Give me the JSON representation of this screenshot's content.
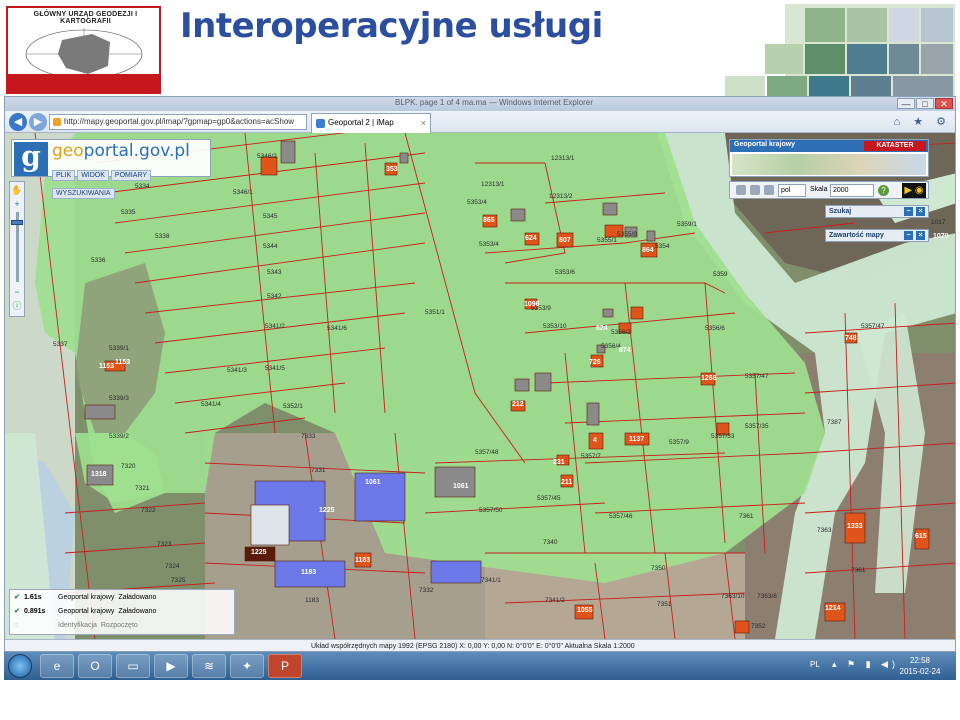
{
  "slide": {
    "logo_text": "GŁÓWNY URZĄD GEODEZJI I KARTOGRAFII",
    "title": "Interoperacyjne usługi"
  },
  "window": {
    "title": "BLPK. page 1 of 4 ma.ma — Windows Internet Explorer",
    "controls": [
      "—",
      "□",
      "✕"
    ]
  },
  "browser": {
    "address": "http://mapy.geoportal.gov.pl/imap/?gpmap=gp0&actions=acShow",
    "tab_title": "Geoportal 2 | iMap",
    "tab_close": "×",
    "back": "◀",
    "forward": "▶",
    "toolbar_icons": "⌂ ★ ⚙"
  },
  "geoportal": {
    "logo_letter": "g",
    "name_prefix": "geo",
    "name_suffix": "portal.gov.pl",
    "menu": [
      "PLIK",
      "WIDOK",
      "POMIARY",
      "WYSZUKIWANIA"
    ]
  },
  "panel": {
    "ref_title": "Geoportal krajowy",
    "ref_button": "KATASTER",
    "lang": "pol",
    "scale_label": "Skala",
    "scale_value": "2000",
    "help": "?",
    "eye": "▶ ◉",
    "search_title": "Szukaj",
    "layers_title": "Zawartość mapy"
  },
  "log": [
    {
      "time": "1.61s",
      "service": "Geoportal krajowy",
      "status": "Załadowano"
    },
    {
      "time": "0.891s",
      "service": "Geoportal krajowy",
      "status": "Załadowano"
    },
    {
      "time": "",
      "service": "Identyfikacja",
      "status": "Rozpoczęto"
    }
  ],
  "status": {
    "text": "Układ współrzędnych mapy 1992 (EPSG 2180)   X: 0,00  Y: 0,00  N: 0°0'0\"  E: 0°0'0\"   Aktualna Skala 1:2000"
  },
  "taskbar": {
    "apps": [
      "e",
      "O",
      "▭",
      "▶",
      "≋",
      "✦",
      "P"
    ],
    "lang": "PL",
    "tray_icons": "▴ ⚑ ▮ ◀)",
    "time": "22:58",
    "date": "2015-02-24"
  },
  "map": {
    "colors": {
      "zone_green": "#9ee08f",
      "parcel_line": "#c81e1e",
      "building_orange": "#e0541c",
      "building_blue": "#6c78e8",
      "building_grey": "#8a8a8a"
    },
    "parcels": [
      {
        "text": "5346/2"
      },
      {
        "text": "5346/1"
      },
      {
        "text": "5335"
      },
      {
        "text": "5334"
      },
      {
        "text": "5338"
      },
      {
        "text": "5345"
      },
      {
        "text": "5344"
      },
      {
        "text": "5343"
      },
      {
        "text": "5342"
      },
      {
        "text": "5341/2"
      },
      {
        "text": "5341/6"
      },
      {
        "text": "5341/3"
      },
      {
        "text": "5341/5"
      },
      {
        "text": "5341/4"
      },
      {
        "text": "5352/1"
      },
      {
        "text": "5336"
      },
      {
        "text": "5337"
      },
      {
        "text": "5339/1"
      },
      {
        "text": "5339/2"
      },
      {
        "text": "5339/3"
      },
      {
        "text": "5351/1"
      },
      {
        "text": "12313/1"
      },
      {
        "text": "12313/2"
      },
      {
        "text": "12313/1"
      },
      {
        "text": "5353/4"
      },
      {
        "text": "5353/4"
      },
      {
        "text": "5353/6"
      },
      {
        "text": "5355/1"
      },
      {
        "text": "5355/8"
      },
      {
        "text": "5354"
      },
      {
        "text": "5359/1"
      },
      {
        "text": "5359"
      },
      {
        "text": "5356/6"
      },
      {
        "text": "5356/2"
      },
      {
        "text": "5356/4"
      },
      {
        "text": "5353/10"
      },
      {
        "text": "5353/9"
      },
      {
        "text": "5357/47"
      },
      {
        "text": "5357/48"
      },
      {
        "text": "5357/35"
      },
      {
        "text": "5357/33"
      },
      {
        "text": "5357/9"
      },
      {
        "text": "5357/7"
      },
      {
        "text": "5357/45"
      },
      {
        "text": "5357/46"
      },
      {
        "text": "5357/50"
      },
      {
        "text": "7331"
      },
      {
        "text": "7333"
      },
      {
        "text": "7320"
      },
      {
        "text": "7321"
      },
      {
        "text": "7322"
      },
      {
        "text": "7323"
      },
      {
        "text": "7324"
      },
      {
        "text": "7325"
      },
      {
        "text": "7332"
      },
      {
        "text": "7340"
      },
      {
        "text": "7341/1"
      },
      {
        "text": "7341/2"
      },
      {
        "text": "7350"
      },
      {
        "text": "7351"
      },
      {
        "text": "7361"
      },
      {
        "text": "7363/10"
      },
      {
        "text": "7363/8"
      },
      {
        "text": "7363"
      },
      {
        "text": "7387"
      },
      {
        "text": "7361"
      },
      {
        "text": "5357/47"
      },
      {
        "text": "7352"
      },
      {
        "text": "1183"
      },
      {
        "text": "1017"
      }
    ],
    "buildings": [
      {
        "text": "353"
      },
      {
        "text": "865"
      },
      {
        "text": "624"
      },
      {
        "text": "807"
      },
      {
        "text": "864"
      },
      {
        "text": "1096"
      },
      {
        "text": "624"
      },
      {
        "text": "874"
      },
      {
        "text": "726"
      },
      {
        "text": "212"
      },
      {
        "text": "1268"
      },
      {
        "text": "1137"
      },
      {
        "text": "4"
      },
      {
        "text": "231"
      },
      {
        "text": "211"
      },
      {
        "text": "1061"
      },
      {
        "text": "1061"
      },
      {
        "text": "1225"
      },
      {
        "text": "1225"
      },
      {
        "text": "1183"
      },
      {
        "text": "1183"
      },
      {
        "text": "1318"
      },
      {
        "text": "1153"
      },
      {
        "text": "1153"
      },
      {
        "text": "1055"
      },
      {
        "text": "1333"
      },
      {
        "text": "1214"
      },
      {
        "text": "615"
      },
      {
        "text": "748"
      },
      {
        "text": "1070"
      }
    ]
  }
}
